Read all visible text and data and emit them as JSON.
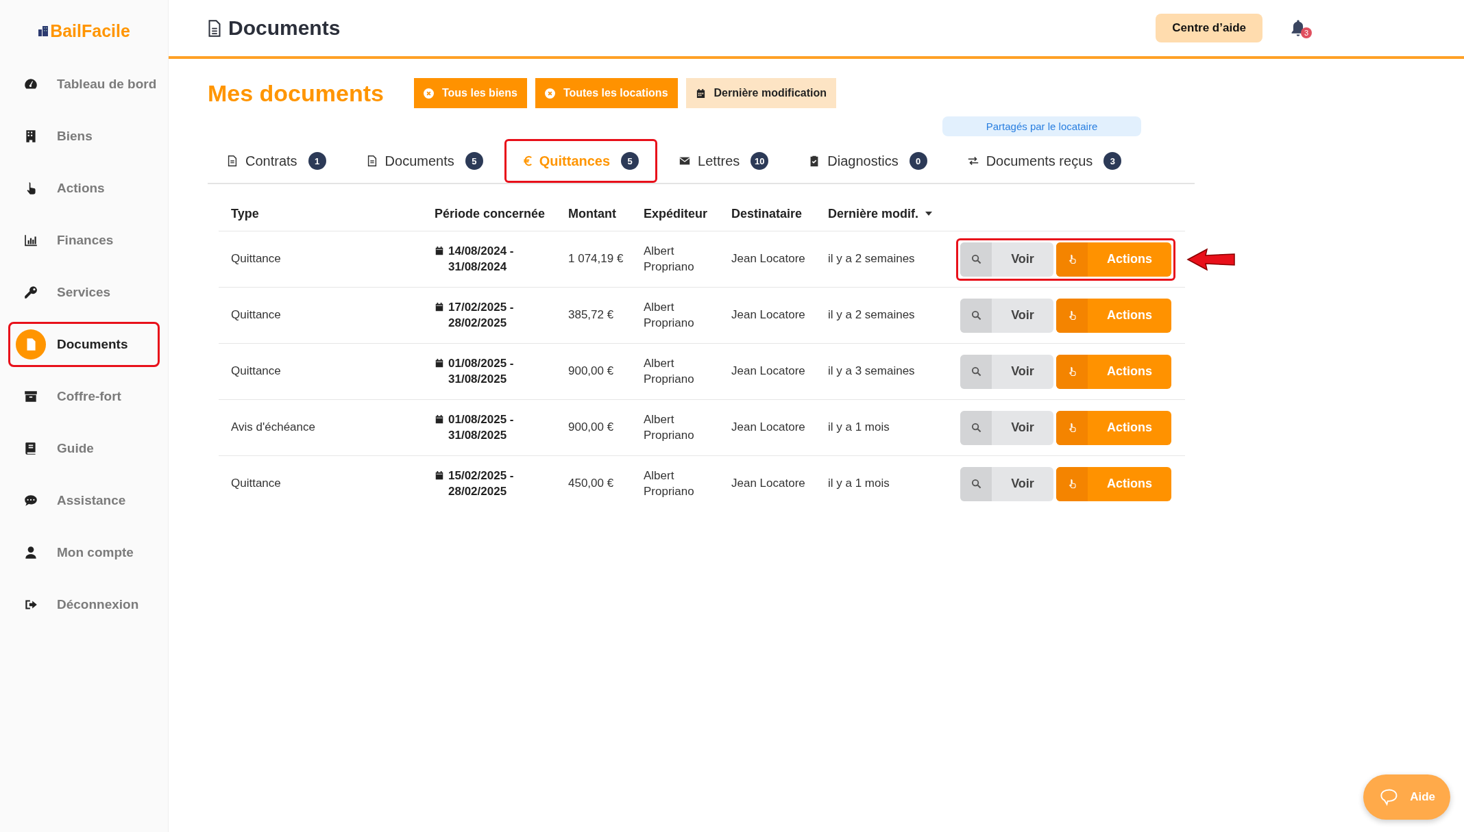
{
  "brand": {
    "name": "BailFacile"
  },
  "sidebar": {
    "items": [
      {
        "label": "Tableau de bord",
        "selected": false,
        "highlighted": false
      },
      {
        "label": "Biens",
        "selected": false,
        "highlighted": false
      },
      {
        "label": "Actions",
        "selected": false,
        "highlighted": false
      },
      {
        "label": "Finances",
        "selected": false,
        "highlighted": false
      },
      {
        "label": "Services",
        "selected": false,
        "highlighted": false
      },
      {
        "label": "Documents",
        "selected": true,
        "highlighted": true
      },
      {
        "label": "Coffre-fort",
        "selected": false,
        "highlighted": false
      },
      {
        "label": "Guide",
        "selected": false,
        "highlighted": false
      },
      {
        "label": "Assistance",
        "selected": false,
        "highlighted": false
      },
      {
        "label": "Mon compte",
        "selected": false,
        "highlighted": false
      },
      {
        "label": "Déconnexion",
        "selected": false,
        "highlighted": false
      }
    ]
  },
  "header": {
    "title": "Documents",
    "help_button": "Centre d’aide",
    "notification_count": "3"
  },
  "page": {
    "title": "Mes documents",
    "filters": [
      {
        "label": "Tous les biens",
        "active": true
      },
      {
        "label": "Toutes les locations",
        "active": true
      },
      {
        "label": "Dernière modification",
        "active": false
      }
    ],
    "shared_note": "Partagés par le locataire"
  },
  "tabs": [
    {
      "label": "Contrats",
      "count": "1",
      "selected": false,
      "highlighted": false
    },
    {
      "label": "Documents",
      "count": "5",
      "selected": false,
      "highlighted": false
    },
    {
      "label": "Quittances",
      "count": "5",
      "selected": true,
      "highlighted": true
    },
    {
      "label": "Lettres",
      "count": "10",
      "selected": false,
      "highlighted": false
    },
    {
      "label": "Diagnostics",
      "count": "0",
      "selected": false,
      "highlighted": false
    },
    {
      "label": "Documents reçus",
      "count": "3",
      "selected": false,
      "highlighted": false
    }
  ],
  "table": {
    "columns": [
      {
        "label": "Type",
        "sorted": false
      },
      {
        "label": "Période concernée",
        "sorted": false
      },
      {
        "label": "Montant",
        "sorted": false
      },
      {
        "label": "Expéditeur",
        "sorted": false
      },
      {
        "label": "Destinataire",
        "sorted": false
      },
      {
        "label": "Dernière modif.",
        "sorted": true
      }
    ],
    "rows": [
      {
        "type": "Quittance",
        "period": "14/08/2024 - 31/08/2024",
        "amount": "1 074,19 €",
        "sender": "Albert Propriano",
        "recipient": "Jean Locatore",
        "modified": "il y a 2 semaines",
        "view": "Voir",
        "actions": "Actions",
        "highlighted": true
      },
      {
        "type": "Quittance",
        "period": "17/02/2025 - 28/02/2025",
        "amount": "385,72 €",
        "sender": "Albert Propriano",
        "recipient": "Jean Locatore",
        "modified": "il y a 2 semaines",
        "view": "Voir",
        "actions": "Actions",
        "highlighted": false
      },
      {
        "type": "Quittance",
        "period": "01/08/2025 - 31/08/2025",
        "amount": "900,00 €",
        "sender": "Albert Propriano",
        "recipient": "Jean Locatore",
        "modified": "il y a 3 semaines",
        "view": "Voir",
        "actions": "Actions",
        "highlighted": false
      },
      {
        "type": "Avis d'échéance",
        "period": "01/08/2025 - 31/08/2025",
        "amount": "900,00 €",
        "sender": "Albert Propriano",
        "recipient": "Jean Locatore",
        "modified": "il y a 1 mois",
        "view": "Voir",
        "actions": "Actions",
        "highlighted": false
      },
      {
        "type": "Quittance",
        "period": "15/02/2025 - 28/02/2025",
        "amount": "450,00 €",
        "sender": "Albert Propriano",
        "recipient": "Jean Locatore",
        "modified": "il y a 1 mois",
        "view": "Voir",
        "actions": "Actions",
        "highlighted": false
      }
    ]
  },
  "help_widget": {
    "label": "Aide"
  }
}
